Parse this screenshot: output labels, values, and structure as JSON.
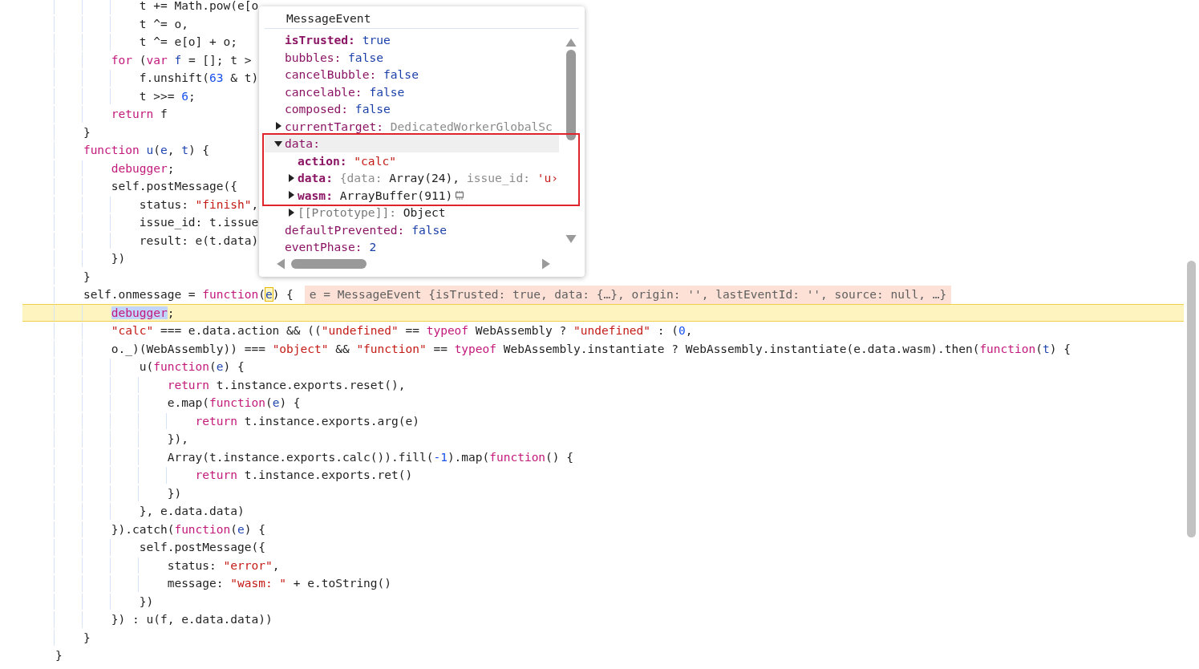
{
  "code": {
    "lines": [
      {
        "paused": false,
        "tokens": [
          {
            "kind": "plain",
            "text": "            t += Math.pow(e[o"
          }
        ]
      },
      {
        "paused": false,
        "tokens": [
          {
            "kind": "plain",
            "text": "            t ^= o,"
          }
        ]
      },
      {
        "paused": false,
        "tokens": [
          {
            "kind": "plain",
            "text": "            t ^= e[o] + o;"
          }
        ]
      },
      {
        "paused": false,
        "tokens": [
          {
            "kind": "keyword",
            "text": "        for"
          },
          {
            "kind": "plain",
            "text": " ("
          },
          {
            "kind": "keyword",
            "text": "var"
          },
          {
            "kind": "name",
            "text": " f"
          },
          {
            "kind": "plain",
            "text": " = []; t >"
          }
        ]
      },
      {
        "paused": false,
        "tokens": [
          {
            "kind": "plain",
            "text": "            f.unshift("
          },
          {
            "kind": "number",
            "text": "63"
          },
          {
            "kind": "plain",
            "text": " & t)"
          }
        ]
      },
      {
        "paused": false,
        "tokens": [
          {
            "kind": "plain",
            "text": "            t >>= "
          },
          {
            "kind": "number",
            "text": "6"
          },
          {
            "kind": "plain",
            "text": ";"
          }
        ]
      },
      {
        "paused": false,
        "tokens": [
          {
            "kind": "keyword",
            "text": "        return"
          },
          {
            "kind": "plain",
            "text": " f"
          }
        ]
      },
      {
        "paused": false,
        "tokens": [
          {
            "kind": "plain",
            "text": "    }"
          }
        ]
      },
      {
        "paused": false,
        "tokens": [
          {
            "kind": "keyword",
            "text": "    function"
          },
          {
            "kind": "name",
            "text": " u"
          },
          {
            "kind": "plain",
            "text": "("
          },
          {
            "kind": "name",
            "text": "e"
          },
          {
            "kind": "plain",
            "text": ", "
          },
          {
            "kind": "name",
            "text": "t"
          },
          {
            "kind": "plain",
            "text": ") {"
          }
        ]
      },
      {
        "paused": false,
        "tokens": [
          {
            "kind": "keyword",
            "text": "        debugger"
          },
          {
            "kind": "plain",
            "text": ";"
          }
        ]
      },
      {
        "paused": false,
        "tokens": [
          {
            "kind": "plain",
            "text": "        self.postMessage({"
          }
        ]
      },
      {
        "paused": false,
        "tokens": [
          {
            "kind": "plain",
            "text": "            status: "
          },
          {
            "kind": "string",
            "text": "\"finish\""
          },
          {
            "kind": "plain",
            "text": ","
          }
        ]
      },
      {
        "paused": false,
        "tokens": [
          {
            "kind": "plain",
            "text": "            issue_id: t.issue"
          }
        ]
      },
      {
        "paused": false,
        "tokens": [
          {
            "kind": "plain",
            "text": "            result: e(t.data)"
          }
        ]
      },
      {
        "paused": false,
        "tokens": [
          {
            "kind": "plain",
            "text": "        })"
          }
        ]
      },
      {
        "paused": false,
        "tokens": [
          {
            "kind": "plain",
            "text": "    }"
          }
        ]
      },
      {
        "paused": false,
        "tokens": [
          {
            "kind": "plain",
            "text": "    self.onmessage = "
          },
          {
            "kind": "keyword",
            "text": "function"
          },
          {
            "kind": "plain",
            "text": "("
          },
          {
            "kind": "focus",
            "text": "e"
          },
          {
            "kind": "plain",
            "text": ") {"
          }
        ],
        "inline_value": "e = MessageEvent {isTrusted: true, data: {…}, origin: '', lastEventId: '', source: null, …}"
      },
      {
        "paused": true,
        "tokens": [
          {
            "kind": "selection",
            "text": "        debugger"
          },
          {
            "kind": "plain",
            "text": ";"
          }
        ]
      },
      {
        "paused": false,
        "tokens": [
          {
            "kind": "string",
            "text": "        \"calc\""
          },
          {
            "kind": "plain",
            "text": " === e.data.action && (("
          },
          {
            "kind": "string",
            "text": "\"undefined\""
          },
          {
            "kind": "plain",
            "text": " == "
          },
          {
            "kind": "keyword",
            "text": "typeof"
          },
          {
            "kind": "plain",
            "text": " WebAssembly ? "
          },
          {
            "kind": "string",
            "text": "\"undefined\""
          },
          {
            "kind": "plain",
            "text": " : ("
          },
          {
            "kind": "number",
            "text": "0"
          },
          {
            "kind": "plain",
            "text": ","
          }
        ]
      },
      {
        "paused": false,
        "tokens": [
          {
            "kind": "plain",
            "text": "        o._)(WebAssembly)) === "
          },
          {
            "kind": "string",
            "text": "\"object\""
          },
          {
            "kind": "plain",
            "text": " && "
          },
          {
            "kind": "string",
            "text": "\"function\""
          },
          {
            "kind": "plain",
            "text": " == "
          },
          {
            "kind": "keyword",
            "text": "typeof"
          },
          {
            "kind": "plain",
            "text": " WebAssembly.instantiate ? WebAssembly.instantiate(e.data.wasm).then("
          },
          {
            "kind": "keyword",
            "text": "function"
          },
          {
            "kind": "plain",
            "text": "("
          },
          {
            "kind": "name",
            "text": "t"
          },
          {
            "kind": "plain",
            "text": ") {"
          }
        ]
      },
      {
        "paused": false,
        "tokens": [
          {
            "kind": "plain",
            "text": "            u("
          },
          {
            "kind": "keyword",
            "text": "function"
          },
          {
            "kind": "plain",
            "text": "("
          },
          {
            "kind": "name",
            "text": "e"
          },
          {
            "kind": "plain",
            "text": ") {"
          }
        ]
      },
      {
        "paused": false,
        "tokens": [
          {
            "kind": "keyword",
            "text": "                return"
          },
          {
            "kind": "plain",
            "text": " t.instance.exports.reset(),"
          }
        ]
      },
      {
        "paused": false,
        "tokens": [
          {
            "kind": "plain",
            "text": "                e.map("
          },
          {
            "kind": "keyword",
            "text": "function"
          },
          {
            "kind": "plain",
            "text": "("
          },
          {
            "kind": "name",
            "text": "e"
          },
          {
            "kind": "plain",
            "text": ") {"
          }
        ]
      },
      {
        "paused": false,
        "tokens": [
          {
            "kind": "keyword",
            "text": "                    return"
          },
          {
            "kind": "plain",
            "text": " t.instance.exports.arg(e)"
          }
        ]
      },
      {
        "paused": false,
        "tokens": [
          {
            "kind": "plain",
            "text": "                }),"
          }
        ]
      },
      {
        "paused": false,
        "tokens": [
          {
            "kind": "plain",
            "text": "                Array(t.instance.exports.calc()).fill("
          },
          {
            "kind": "number",
            "text": "-1"
          },
          {
            "kind": "plain",
            "text": ").map("
          },
          {
            "kind": "keyword",
            "text": "function"
          },
          {
            "kind": "plain",
            "text": "() {"
          }
        ]
      },
      {
        "paused": false,
        "tokens": [
          {
            "kind": "keyword",
            "text": "                    return"
          },
          {
            "kind": "plain",
            "text": " t.instance.exports.ret()"
          }
        ]
      },
      {
        "paused": false,
        "tokens": [
          {
            "kind": "plain",
            "text": "                })"
          }
        ]
      },
      {
        "paused": false,
        "tokens": [
          {
            "kind": "plain",
            "text": "            }, e.data.data)"
          }
        ]
      },
      {
        "paused": false,
        "tokens": [
          {
            "kind": "plain",
            "text": "        }).catch("
          },
          {
            "kind": "keyword",
            "text": "function"
          },
          {
            "kind": "plain",
            "text": "("
          },
          {
            "kind": "name",
            "text": "e"
          },
          {
            "kind": "plain",
            "text": ") {"
          }
        ]
      },
      {
        "paused": false,
        "tokens": [
          {
            "kind": "plain",
            "text": "            self.postMessage({"
          }
        ]
      },
      {
        "paused": false,
        "tokens": [
          {
            "kind": "plain",
            "text": "                status: "
          },
          {
            "kind": "string",
            "text": "\"error\""
          },
          {
            "kind": "plain",
            "text": ","
          }
        ]
      },
      {
        "paused": false,
        "tokens": [
          {
            "kind": "plain",
            "text": "                message: "
          },
          {
            "kind": "string",
            "text": "\"wasm: \""
          },
          {
            "kind": "plain",
            "text": " + e.toString()"
          }
        ]
      },
      {
        "paused": false,
        "tokens": [
          {
            "kind": "plain",
            "text": "            })"
          }
        ]
      },
      {
        "paused": false,
        "tokens": [
          {
            "kind": "plain",
            "text": "        }) : u(f, e.data.data))"
          }
        ]
      },
      {
        "paused": false,
        "tokens": [
          {
            "kind": "plain",
            "text": "    }"
          }
        ]
      },
      {
        "paused": false,
        "tokens": [
          {
            "kind": "plain",
            "text": "}"
          }
        ]
      }
    ]
  },
  "inspector": {
    "title": "MessageEvent",
    "properties": [
      {
        "key": "isTrusted:",
        "kind": "own",
        "selected": false,
        "value": [
          {
            "kind": "boolean",
            "text": "true"
          }
        ]
      },
      {
        "key": "bubbles:",
        "kind": "inherited",
        "selected": false,
        "value": [
          {
            "kind": "boolean",
            "text": "false"
          }
        ]
      },
      {
        "key": "cancelBubble:",
        "kind": "inherited",
        "selected": false,
        "value": [
          {
            "kind": "boolean",
            "text": "false"
          }
        ]
      },
      {
        "key": "cancelable:",
        "kind": "inherited",
        "selected": false,
        "value": [
          {
            "kind": "boolean",
            "text": "false"
          }
        ]
      },
      {
        "key": "composed:",
        "kind": "inherited",
        "selected": false,
        "value": [
          {
            "kind": "boolean",
            "text": "false"
          }
        ]
      },
      {
        "key": "currentTarget:",
        "kind": "inherited",
        "selected": false,
        "expanded": false,
        "value": [
          {
            "kind": "dim",
            "text": "DedicatedWorkerGlobalSc"
          }
        ]
      },
      {
        "key": "data:",
        "kind": "inherited",
        "selected": true,
        "expanded": true,
        "annotated": true,
        "children": [
          {
            "key": "action:",
            "kind": "own",
            "value": [
              {
                "kind": "string",
                "text": "\"calc\""
              }
            ]
          },
          {
            "key": "data:",
            "kind": "own",
            "expanded": false,
            "value": [
              {
                "kind": "dim",
                "text": "{data:"
              },
              {
                "kind": "plain",
                "text": "Array(24),"
              },
              {
                "kind": "dim",
                "text": "issue_id:"
              },
              {
                "kind": "string",
                "text": "'u›"
              }
            ]
          },
          {
            "key": "wasm:",
            "kind": "own",
            "expanded": false,
            "value": [
              {
                "kind": "buffer",
                "text": "ArrayBuffer(911)"
              }
            ]
          },
          {
            "key": "[[Prototype]]:",
            "kind": "internal",
            "expanded": false,
            "value": [
              {
                "kind": "plain",
                "text": "Object"
              }
            ]
          }
        ]
      },
      {
        "key": "defaultPrevented:",
        "kind": "inherited",
        "selected": false,
        "value": [
          {
            "kind": "boolean",
            "text": "false"
          }
        ]
      },
      {
        "key": "eventPhase:",
        "kind": "inherited",
        "selected": false,
        "value": [
          {
            "kind": "number",
            "text": "2"
          }
        ]
      }
    ]
  }
}
